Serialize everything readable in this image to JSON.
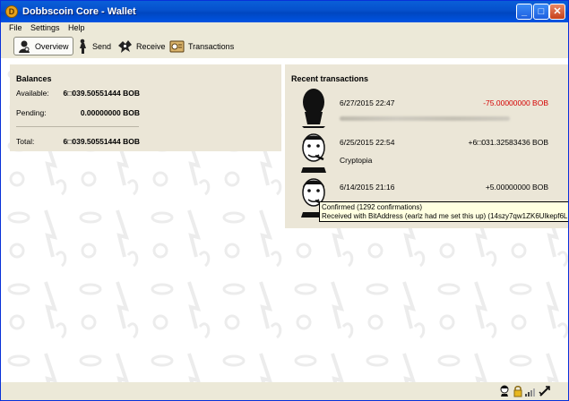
{
  "window": {
    "title": "Dobbscoin Core - Wallet"
  },
  "titlebar": {
    "minimize": "_",
    "maximize": "□",
    "close": "✕"
  },
  "menu": [
    "File",
    "Settings",
    "Help"
  ],
  "toolbar": {
    "overview": "Overview",
    "send": "Send",
    "receive": "Receive",
    "transactions": "Transactions"
  },
  "balances": {
    "title": "Balances",
    "available_label": "Available:",
    "available": "6□039.50551444 BOB",
    "pending_label": "Pending:",
    "pending": "0.00000000 BOB",
    "total_label": "Total:",
    "total": "6□039.50551444 BOB"
  },
  "recent": {
    "title": "Recent transactions",
    "items": [
      {
        "date": "6/27/2015 22:47",
        "amount": "-75.00000000 BOB",
        "label": "",
        "amount_color": "#d40000"
      },
      {
        "date": "6/25/2015 22:54",
        "amount": "+6□031.32583436 BOB",
        "label": "Cryptopia",
        "amount_color": "#000000"
      },
      {
        "date": "6/14/2015 21:16",
        "amount": "+5.00000000 BOB",
        "label": "",
        "amount_color": "#000000"
      }
    ]
  },
  "tooltip": {
    "line1": "Confirmed (1292 confirmations)",
    "line2": "Received with BitAddress (earlz had me set this up) (14szy7qw1ZK6Ulkepf6L"
  },
  "status_icons": [
    "bob-icon",
    "lock-icon",
    "signal-bars-icon",
    "sync-check-icon"
  ]
}
